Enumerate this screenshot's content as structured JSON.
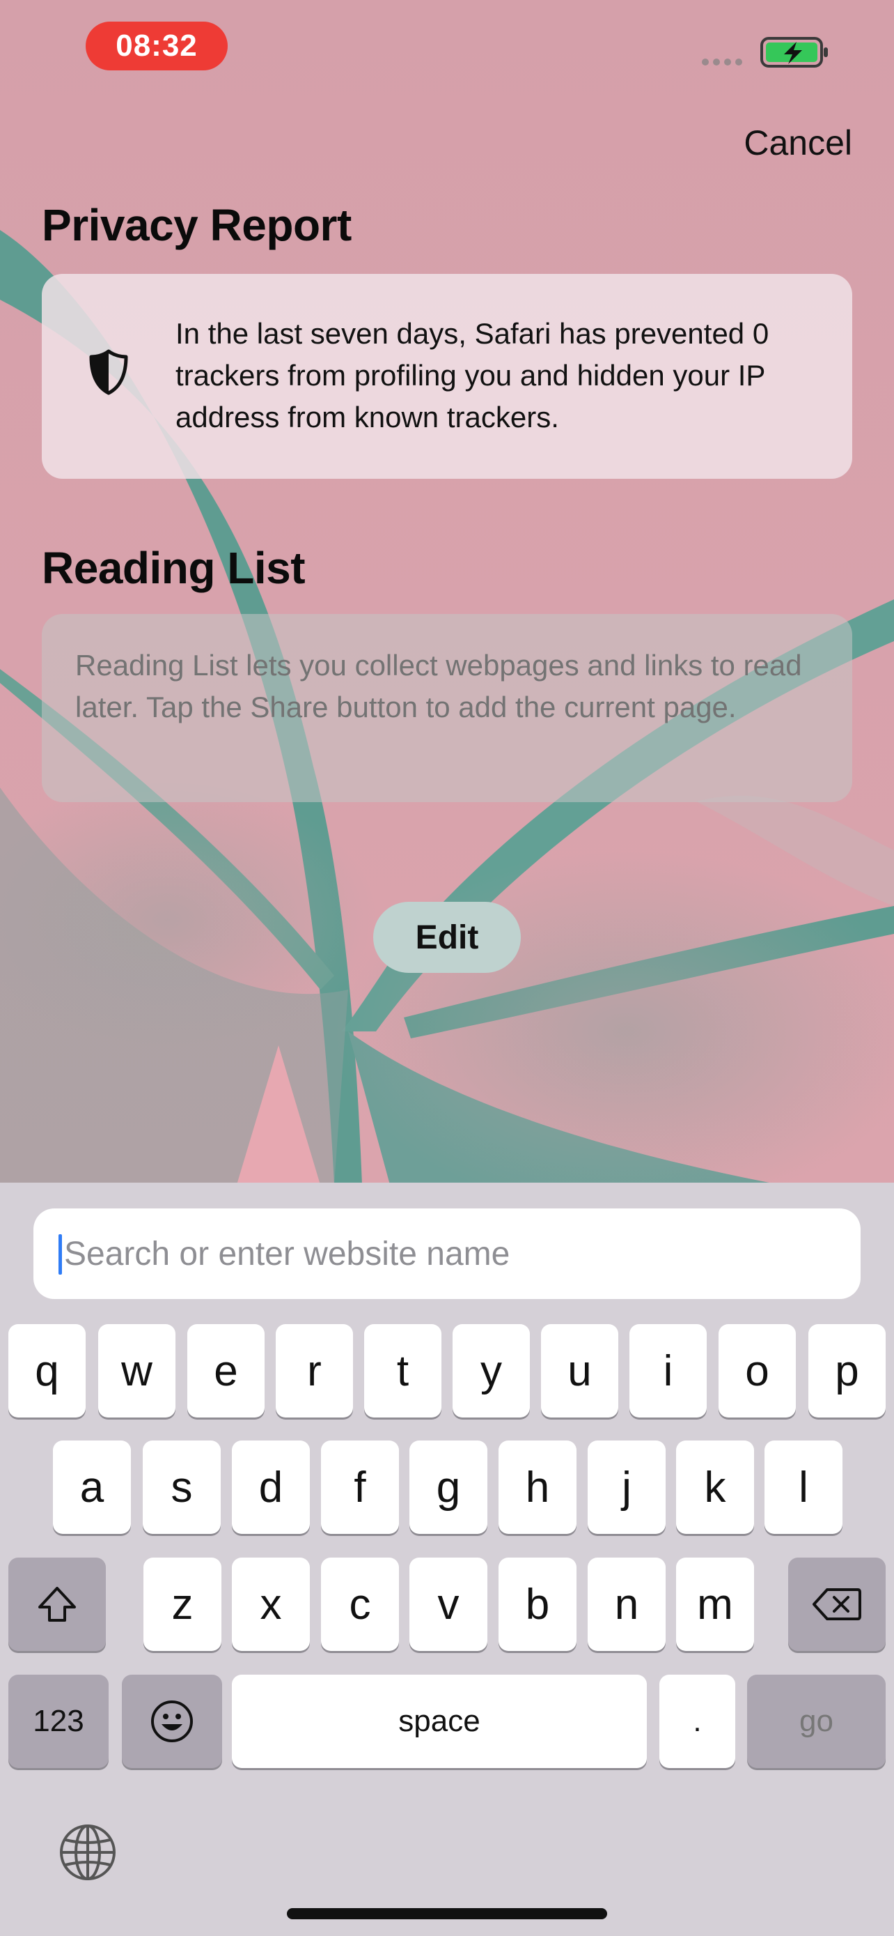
{
  "status_bar": {
    "time": "08:32",
    "battery_icon": "battery-charging-icon",
    "signal_icon": "signal-dots-icon"
  },
  "header": {
    "cancel_label": "Cancel"
  },
  "privacy_report": {
    "title": "Privacy Report",
    "icon": "shield-icon",
    "text": "In the last seven days, Safari has prevented 0 trackers from profiling you and hidden your IP address from known trackers."
  },
  "reading_list": {
    "title": "Reading List",
    "text": "Reading List lets you collect webpages and links to read later. Tap the Share button to add the current page."
  },
  "edit_label": "Edit",
  "search": {
    "placeholder": "Search or enter website name",
    "value": ""
  },
  "keyboard": {
    "row1": [
      "q",
      "w",
      "e",
      "r",
      "t",
      "y",
      "u",
      "i",
      "o",
      "p"
    ],
    "row2": [
      "a",
      "s",
      "d",
      "f",
      "g",
      "h",
      "j",
      "k",
      "l"
    ],
    "row3": [
      "z",
      "x",
      "c",
      "v",
      "b",
      "n",
      "m"
    ],
    "shift_icon": "shift-icon",
    "delete_icon": "backspace-icon",
    "numbers_label": "123",
    "emoji_icon": "emoji-icon",
    "space_label": "space",
    "period_label": ".",
    "go_label": "go",
    "globe_icon": "globe-icon"
  },
  "colors": {
    "time_pill": "#ee3b35",
    "background_pink": "#d5a1ab",
    "background_teal": "#5f9c91",
    "keyboard_bg": "#d5d0d7",
    "caret": "#2f7cf6"
  }
}
